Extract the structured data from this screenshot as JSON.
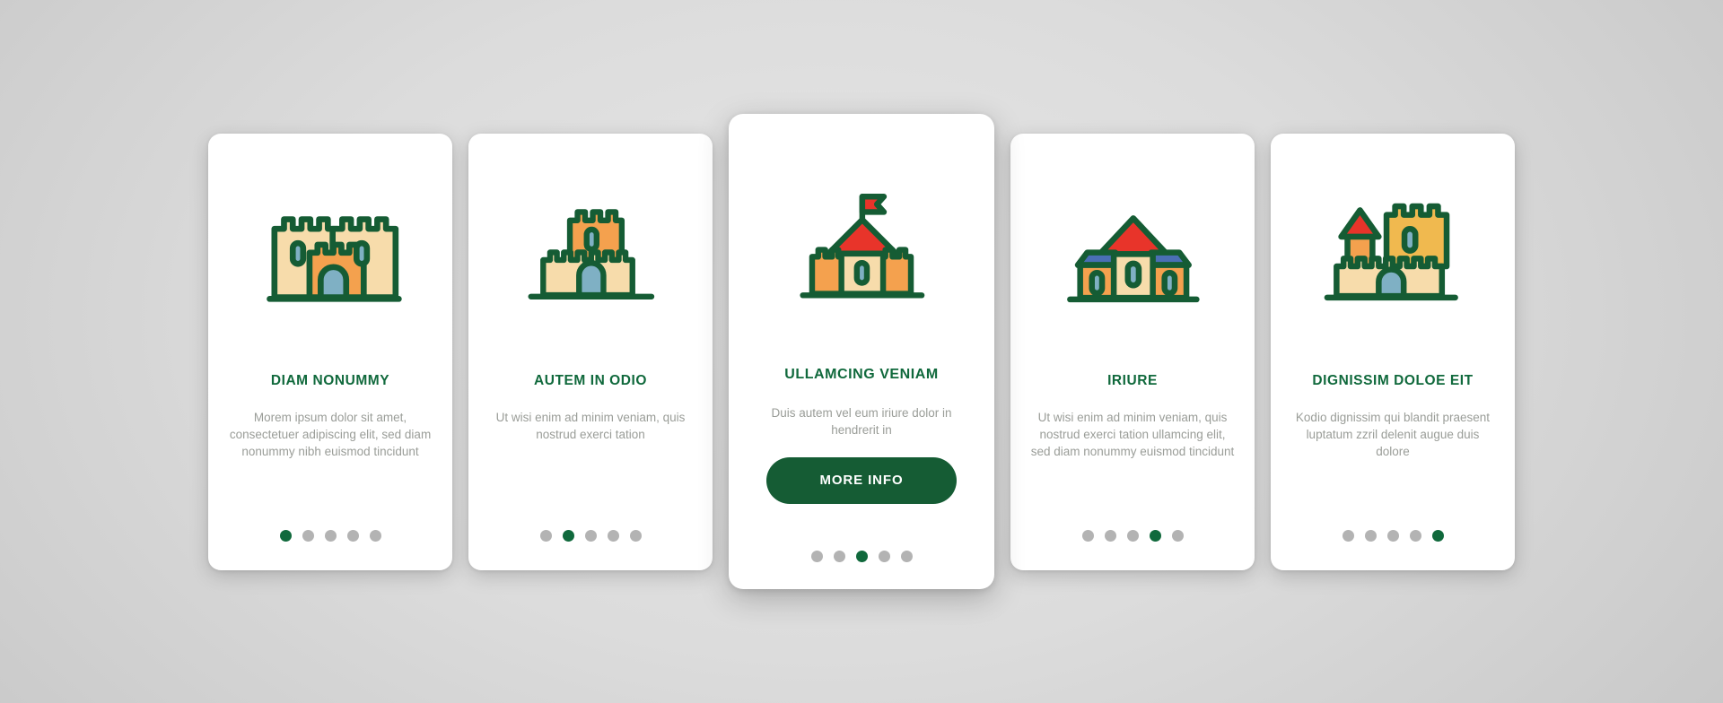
{
  "theme": {
    "accent_green": "#10693c",
    "button_green": "#155c34",
    "body_text_gray": "#9a9d98",
    "dot_inactive_gray": "#b3b3b3",
    "card_background": "#ffffff",
    "page_background": "#d9d9d9",
    "icon_outline": "#155c34",
    "icon_cream": "#f7dcab",
    "icon_orange": "#f4a14e",
    "icon_gold": "#f0b94f",
    "icon_blue": "#7fb0c4",
    "icon_red": "#e8342a",
    "icon_roof_blue": "#4a6fb5"
  },
  "cards": [
    {
      "icon": "castle-two-towers-icon",
      "title": "DIAM NONUMMY",
      "body": "Morem ipsum dolor sit amet, consectetuer adipiscing elit, sed diam nonummy nibh euismod tincidunt",
      "dots": {
        "count": 5,
        "active_index": 0
      },
      "featured": false,
      "cta": null
    },
    {
      "icon": "castle-single-keep-icon",
      "title": "AUTEM IN ODIO",
      "body": "Ut wisi enim ad minim veniam, quis nostrud exerci tation",
      "dots": {
        "count": 5,
        "active_index": 1
      },
      "featured": false,
      "cta": null
    },
    {
      "icon": "castle-flag-tower-icon",
      "title": "ULLAMCING VENIAM",
      "body": "Duis autem vel eum iriure dolor in hendrerit in",
      "dots": {
        "count": 5,
        "active_index": 2
      },
      "featured": true,
      "cta": "MORE INFO"
    },
    {
      "icon": "castle-manor-house-icon",
      "title": "IRIURE",
      "body": "Ut wisi enim ad minim veniam, quis nostrud exerci tation ullamcing elit, sed diam nonummy euismod tincidunt",
      "dots": {
        "count": 5,
        "active_index": 3
      },
      "featured": false,
      "cta": null
    },
    {
      "icon": "castle-fortress-icon",
      "title": "DIGNISSIM DOLOE EIT",
      "body": "Kodio dignissim qui blandit praesent luptatum zzril delenit augue duis dolore",
      "dots": {
        "count": 5,
        "active_index": 4
      },
      "featured": false,
      "cta": null
    }
  ]
}
